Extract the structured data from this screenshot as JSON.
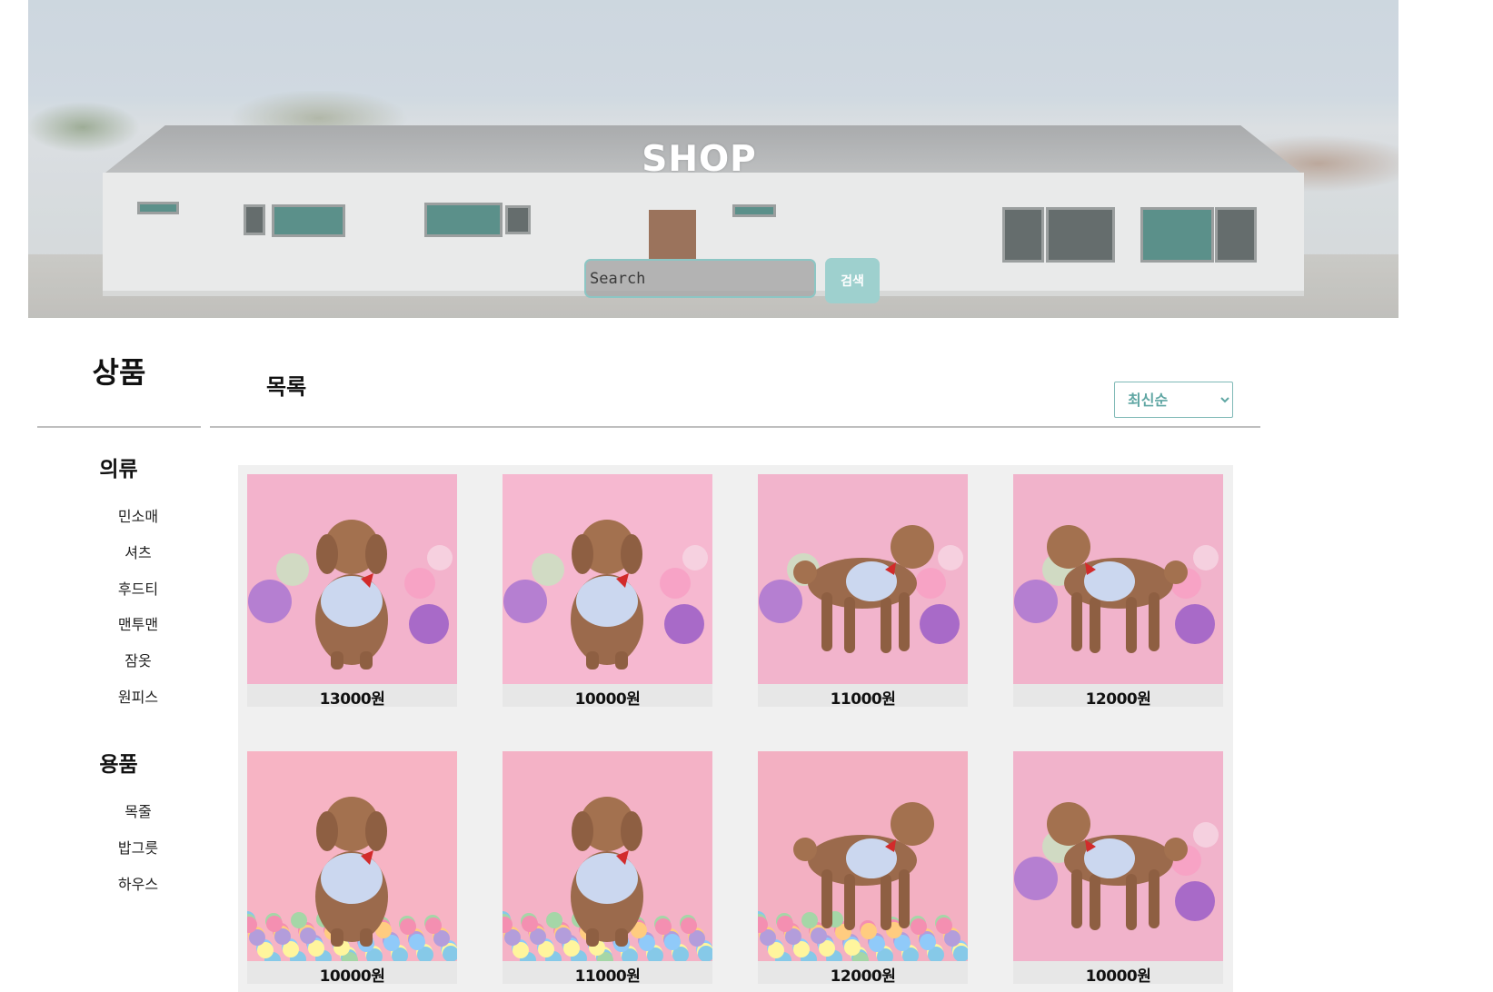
{
  "hero": {
    "title": "SHOP",
    "search_placeholder": "Search",
    "search_button": "검색"
  },
  "sidebar": {
    "title": "상품",
    "categories": [
      {
        "heading": "의류",
        "items": [
          "민소매",
          "셔츠",
          "후드티",
          "맨투맨",
          "잠옷",
          "원피스"
        ]
      },
      {
        "heading": "용품",
        "items": [
          "목줄",
          "밥그릇",
          "하우스"
        ]
      }
    ]
  },
  "main": {
    "title": "목록",
    "sort": {
      "selected": "최신순"
    },
    "products": [
      {
        "price": "13000원",
        "bg": "#f3b3cc",
        "pose": "sit-back"
      },
      {
        "price": "10000원",
        "bg": "#f6b8d0",
        "pose": "sit-front"
      },
      {
        "price": "11000원",
        "bg": "#f2b4cc",
        "pose": "stand-left"
      },
      {
        "price": "12000원",
        "bg": "#f1b3cb",
        "pose": "stand-right"
      },
      {
        "price": "10000원",
        "bg": "#f7b4c4",
        "pose": "sit-balls"
      },
      {
        "price": "11000원",
        "bg": "#f4b2c6",
        "pose": "sit-front-balls"
      },
      {
        "price": "12000원",
        "bg": "#f3b0c2",
        "pose": "stand-balls"
      },
      {
        "price": "10000원",
        "bg": "#f1b3cb",
        "pose": "stand-right"
      }
    ]
  },
  "colors": {
    "accent": "#9ed0ce",
    "select_text": "#5fa6a3",
    "panel_bg": "#f0f0f0"
  }
}
